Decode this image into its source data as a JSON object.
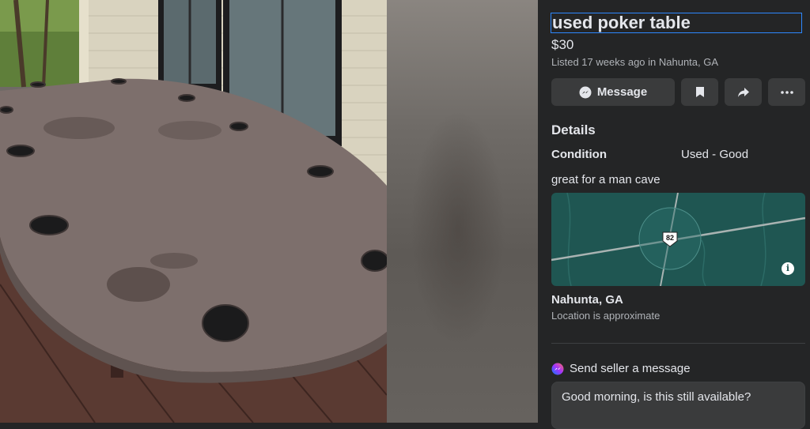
{
  "listing": {
    "title": "used poker table",
    "price": "$30",
    "meta": "Listed 17 weeks ago in Nahunta, GA"
  },
  "actions": {
    "message_label": "Message",
    "message_icon": "messenger-icon",
    "save_icon": "bookmark-icon",
    "share_icon": "share-icon",
    "more_icon": "more-icon"
  },
  "details": {
    "heading": "Details",
    "condition_label": "Condition",
    "condition_value": "Used - Good",
    "description": "great for a man cave"
  },
  "map": {
    "route_marker": "82",
    "info_icon": "info-icon"
  },
  "location": {
    "name": "Nahunta, GA",
    "note": "Location is approximate"
  },
  "seller_message": {
    "heading": "Send seller a message",
    "text": "Good morning, is this still available?"
  },
  "colors": {
    "panel_bg": "#242526",
    "accent": "#2d88ff",
    "button_bg": "#3a3b3c",
    "map_bg": "#1f5652"
  }
}
